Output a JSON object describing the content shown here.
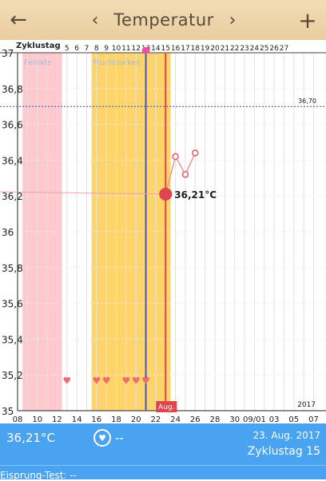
{
  "header": {
    "title": "Temperatur",
    "back_icon": "arrow-left-icon",
    "prev_icon": "chevron-left-icon",
    "next_icon": "chevron-right-icon",
    "add_icon": "plus-icon"
  },
  "chart_data": {
    "type": "line",
    "title": "",
    "cycle_label": "Zyklustag",
    "cycle_days": [
      "5",
      "6",
      "7",
      "8",
      "9",
      "10",
      "11",
      "12",
      "13",
      "14",
      "15",
      "16",
      "17",
      "18",
      "19",
      "20",
      "21",
      "22",
      "23",
      "24",
      "25",
      "26",
      "27"
    ],
    "x_ticks": [
      "08",
      "10",
      "12",
      "14",
      "16",
      "18",
      "20",
      "22",
      "24",
      "26",
      "28",
      "30",
      "09/01",
      "03",
      "05",
      "07"
    ],
    "y_ticks": [
      "37",
      "36,8",
      "36,6",
      "36,4",
      "36,2",
      "36",
      "35,8",
      "35,6",
      "35,4",
      "35,2",
      "35"
    ],
    "ylim": [
      35,
      37
    ],
    "reference_line": {
      "label": "36,70",
      "value": 36.7
    },
    "series": [
      {
        "x": [
          "Aug 23",
          "Aug 24",
          "Aug 25",
          "Aug 26"
        ],
        "y": [
          36.21,
          36.42,
          36.32,
          36.44
        ]
      }
    ],
    "current_point": {
      "label": "36,21°C",
      "x": "Aug 23",
      "y": 36.21
    },
    "bands": [
      {
        "label": "Periode",
        "from": "Aug 9",
        "to": "Aug 12",
        "color": "#ffc9cd"
      },
      {
        "label": "Fruchtbarkeit",
        "from": "Aug 16",
        "to": "Aug 23",
        "color": "#ffd46b"
      }
    ],
    "ovulation_marker": {
      "x": "Aug 21",
      "color": "#3f57c4"
    },
    "today_marker": {
      "label": "Aug.",
      "x": "Aug 23",
      "color": "#e0444c"
    },
    "hearts": [
      "Aug 13",
      "Aug 16",
      "Aug 17",
      "Aug 19",
      "Aug 20",
      "Aug 21"
    ],
    "year_label": "2017"
  },
  "bottom": {
    "temperature": "36,21°C",
    "heart_icon": "heart-icon",
    "heart_value": "--",
    "date": "23. Aug. 2017",
    "cycle_day": "Zyklustag 15",
    "ovulation_test": "Eisprung-Test: --"
  }
}
